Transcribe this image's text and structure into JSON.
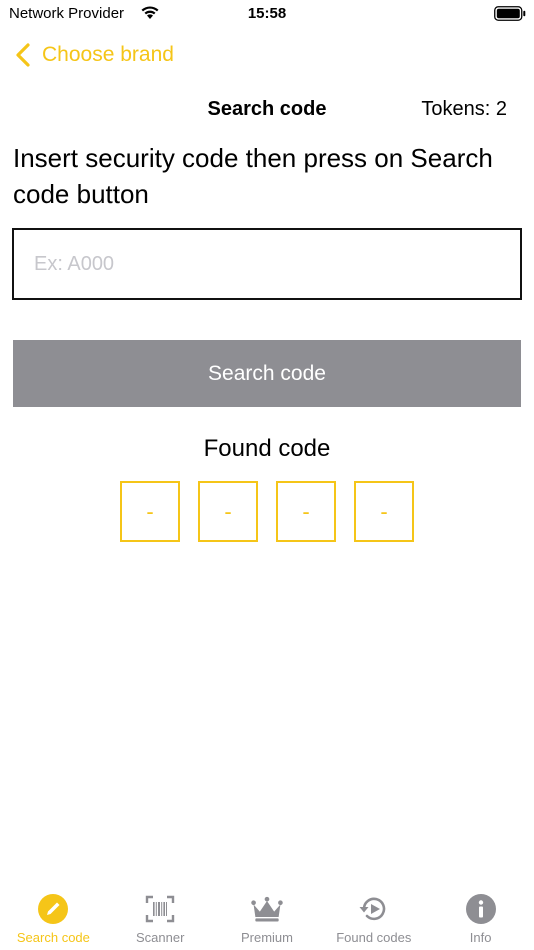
{
  "status_bar": {
    "carrier": "Network Provider",
    "time": "15:58"
  },
  "nav": {
    "back_label": "Choose brand"
  },
  "header": {
    "title": "Search code",
    "tokens": "Tokens: 2"
  },
  "instruction": "Insert security code then press on Search code button",
  "input": {
    "placeholder": "Ex: A000",
    "value": ""
  },
  "search_button": {
    "label": "Search code"
  },
  "found": {
    "label": "Found code",
    "digits": [
      "-",
      "-",
      "-",
      "-"
    ]
  },
  "tabs": [
    {
      "label": "Search code",
      "icon": "pencil-icon",
      "active": true
    },
    {
      "label": "Scanner",
      "icon": "barcode-scanner-icon",
      "active": false
    },
    {
      "label": "Premium",
      "icon": "crown-icon",
      "active": false
    },
    {
      "label": "Found codes",
      "icon": "history-icon",
      "active": false
    },
    {
      "label": "Info",
      "icon": "info-icon",
      "active": false
    }
  ],
  "colors": {
    "accent": "#f5c518",
    "button": "#8e8e93",
    "inactive": "#8e8e93"
  }
}
